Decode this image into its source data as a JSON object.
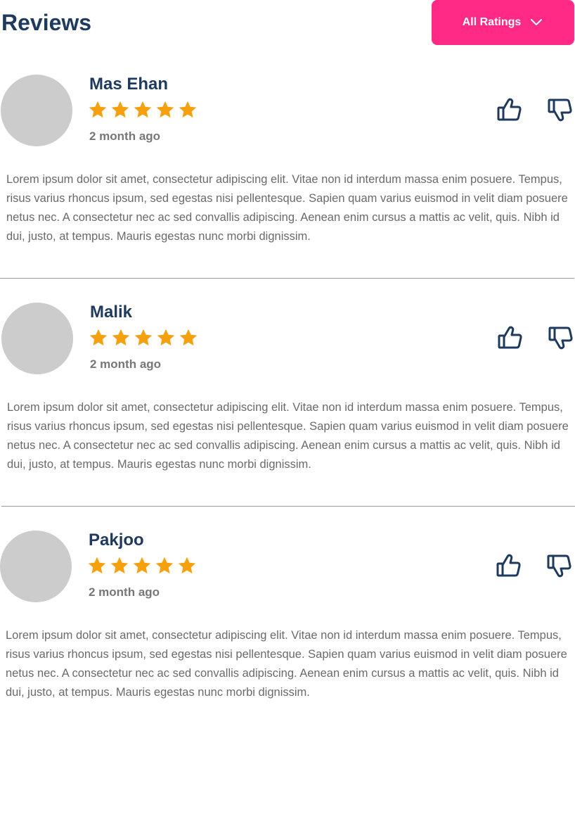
{
  "header": {
    "title": "Reviews",
    "filter_label": "All Ratings",
    "filter_icon": "chevron-down-icon",
    "filter_color": "#ff2a85"
  },
  "colors": {
    "title": "#1e3a5f",
    "star": "#f5a00f",
    "text": "#6a6a6a",
    "avatar": "#cccccc"
  },
  "reviews": [
    {
      "name": "Mas Ehan",
      "rating": 5,
      "time": "2 month ago",
      "text": "Lorem ipsum dolor sit amet, consectetur adipiscing elit. Vitae non id interdum massa enim posuere. Tempus, risus varius rhoncus ipsum, sed egestas nisi pellentesque. Sapien quam varius euismod in velit diam posuere netus nec. A consectetur nec ac sed convallis adipiscing. Aenean enim cursus a mattis ac velit, quis. Nibh id dui, justo, at tempus. Mauris egestas nunc morbi dignissim."
    },
    {
      "name": "Malik",
      "rating": 5,
      "time": "2 month ago",
      "text": "Lorem ipsum dolor sit amet, consectetur adipiscing elit. Vitae non id interdum massa enim posuere. Tempus, risus varius rhoncus ipsum, sed egestas nisi pellentesque. Sapien quam varius euismod in velit diam posuere netus nec. A consectetur nec ac sed convallis adipiscing. Aenean enim cursus a mattis ac velit, quis. Nibh id dui, justo, at tempus. Mauris egestas nunc morbi dignissim."
    },
    {
      "name": "Pakjoo",
      "rating": 5,
      "time": "2 month ago",
      "text": "Lorem ipsum dolor sit amet, consectetur adipiscing elit. Vitae non id interdum massa enim posuere. Tempus, risus varius rhoncus ipsum, sed egestas nisi pellentesque. Sapien quam varius euismod in velit diam posuere netus nec. A consectetur nec ac sed convallis adipiscing. Aenean enim cursus a mattis ac velit, quis. Nibh id dui, justo, at tempus. Mauris egestas nunc morbi dignissim."
    }
  ]
}
